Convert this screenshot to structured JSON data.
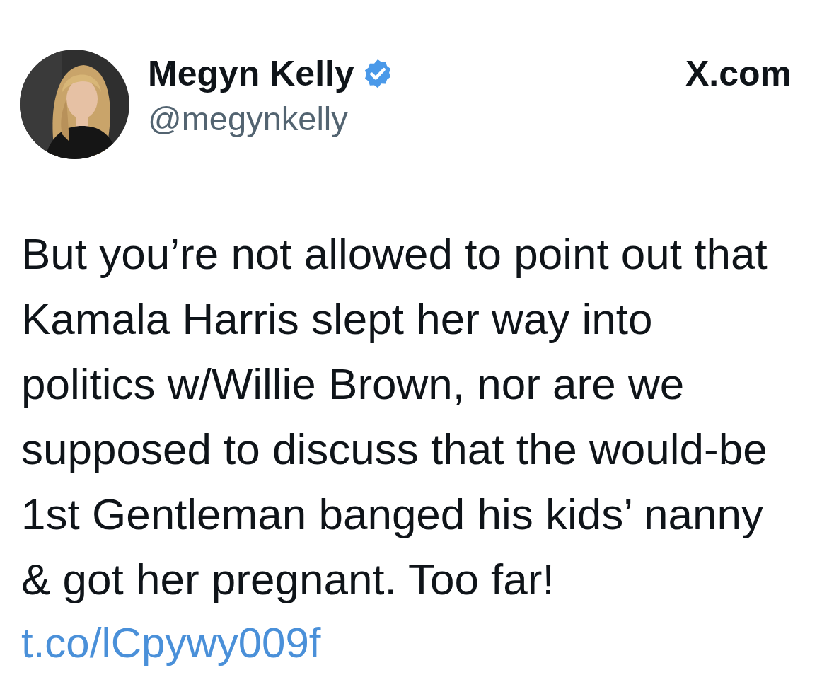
{
  "author": {
    "name": "Megyn Kelly",
    "verified": true,
    "handle": "@megynkelly"
  },
  "source": "X.com",
  "post": {
    "text": "But you’re not allowed to point out that Kamala Harris slept her way into politics w/Willie Brown, nor are we supposed to discuss that the would-be 1st Gentleman banged his kids’ nanny & got her pregnant. Too far!",
    "link": "t.co/lCpywy009f"
  }
}
